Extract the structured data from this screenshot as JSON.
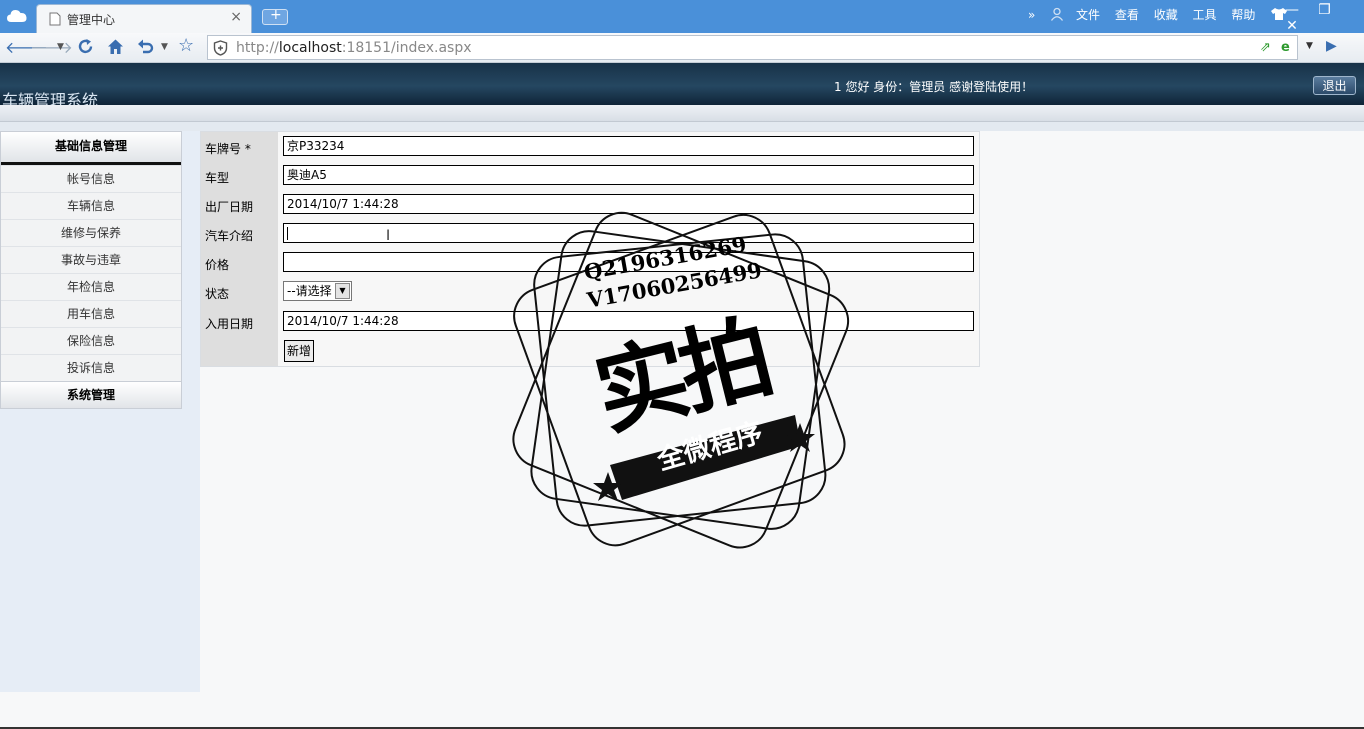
{
  "browser": {
    "tab_title": "管理中心",
    "tab_close": "×",
    "new_tab": "+",
    "url_host": "http://",
    "url_bold": "localhost",
    "url_rest": ":18151/index.aspx",
    "menus": [
      "»",
      "文件",
      "查看",
      "收藏",
      "工具",
      "帮助"
    ],
    "window_buttons": [
      "—",
      "❐",
      "✕"
    ]
  },
  "header": {
    "site_title": "车辆管理系统",
    "greeting": "1 您好 身份：管理员 感谢登陆使用！",
    "logout_label": "退出"
  },
  "sidebar": {
    "group1_title": "基础信息管理",
    "items": [
      "帐号信息",
      "车辆信息",
      "维修与保养",
      "事故与违章",
      "年检信息",
      "用车信息",
      "保险信息",
      "投诉信息"
    ],
    "group2_title": "系统管理"
  },
  "form": {
    "plate_label": "车牌号 *",
    "plate_value": "京P33234",
    "model_label": "车型",
    "model_value": "奥迪A5",
    "factory_date_label": "出厂日期",
    "factory_date_value": "2014/10/7 1:44:28",
    "intro_label": "汽车介绍",
    "intro_value": "",
    "price_label": "价格",
    "price_value": "",
    "status_label": "状态",
    "status_selected": "--请选择",
    "use_date_label": "入用日期",
    "use_date_value": "2014/10/7 1:44:28",
    "submit_label": "新增"
  },
  "watermark": {
    "line1": "Q2196316269",
    "line2": "V17060256499",
    "big": "实拍",
    "banner": "全微程序"
  }
}
